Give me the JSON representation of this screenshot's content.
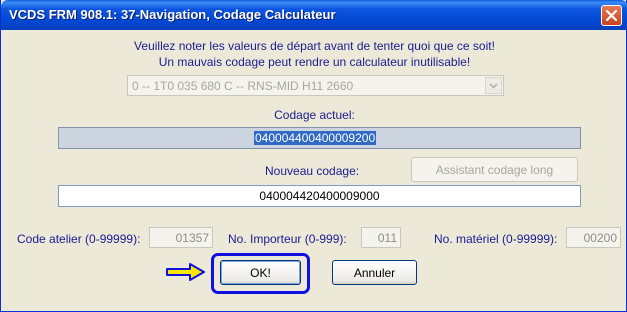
{
  "window": {
    "title": "VCDS FRM 908.1: 37-Navigation,  Codage Calculateur",
    "close_icon": "close-x-icon"
  },
  "warning": {
    "line1": "Veuillez noter les valeurs de départ avant de tenter quoi que ce soit!",
    "line2": "Un mauvais codage peut rendre un calculateur inutilisable!"
  },
  "module_select": {
    "value": "0 -- 1T0 035 680 C -- RNS-MID        H11 2660",
    "enabled": false
  },
  "current_coding": {
    "label": "Codage actuel:",
    "value": "040004400400009200"
  },
  "new_coding": {
    "label": "Nouveau codage:",
    "value": "040004420400009000"
  },
  "assistant_button": {
    "label": "Assistant codage long",
    "enabled": false
  },
  "shop_code": {
    "label": "Code atelier (0-99999):",
    "value": "01357"
  },
  "importer": {
    "label": "No. Importeur (0-999):",
    "value": "011"
  },
  "equipment": {
    "label": "No. matériel (0-99999):",
    "value": "00200"
  },
  "buttons": {
    "ok": "OK!",
    "cancel": "Annuler"
  },
  "colors": {
    "titlebar": "#0348d3",
    "text": "#1b1b8f",
    "highlight": "#1010e0",
    "arrow": "#ffe800",
    "selection": "#316ac5"
  }
}
